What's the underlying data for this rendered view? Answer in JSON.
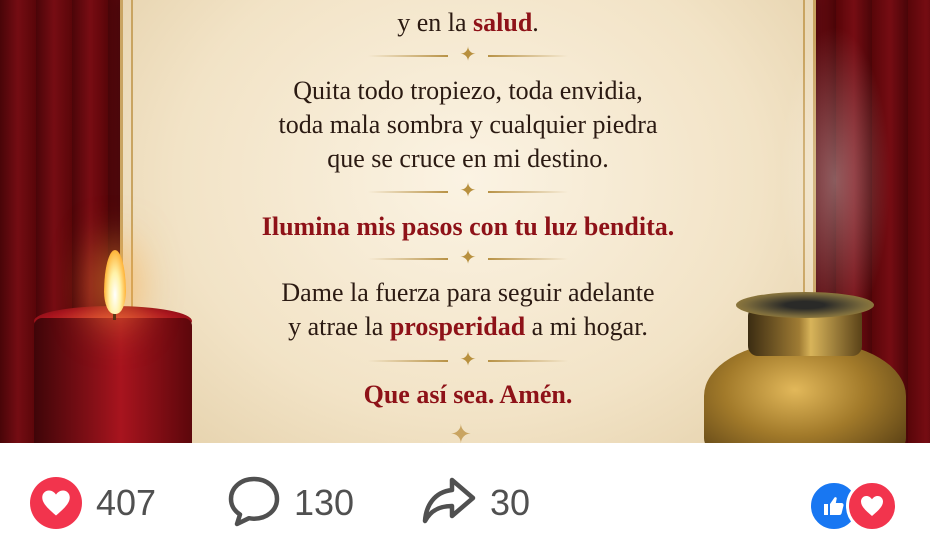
{
  "post": {
    "prayer_lines": {
      "l1_pre": "y en la ",
      "l1_hl": "salud",
      "l1_post": ".",
      "l2": "Quita todo tropiezo, toda envidia,",
      "l3": "toda mala sombra y cualquier piedra",
      "l4": "que se cruce en mi destino.",
      "l5": "Ilumina mis pasos con tu luz bendita.",
      "l6": "Dame la fuerza para seguir adelante",
      "l7_pre": "y atrae la ",
      "l7_hl": "prosperidad",
      "l7_post": " a mi hogar.",
      "l8": "Que así sea. Amén."
    }
  },
  "engagement": {
    "reactions_count": "407",
    "comments_count": "130",
    "shares_count": "30",
    "reaction_icon": "love-heart-icon",
    "comment_icon": "comment-bubble-icon",
    "share_icon": "share-arrow-icon",
    "summary_icons": [
      "like-thumb-icon",
      "love-heart-icon"
    ]
  },
  "colors": {
    "love": "#f2344d",
    "like": "#1877f2",
    "count_text": "#505050",
    "prayer_accent": "#8e1218"
  }
}
